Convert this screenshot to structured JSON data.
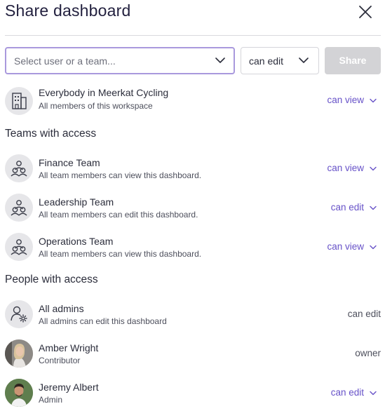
{
  "dialog": {
    "title": "Share dashboard"
  },
  "share_bar": {
    "select_placeholder": "Select user or a team...",
    "permission_value": "can edit",
    "share_label": "Share"
  },
  "everyone": {
    "name": "Everybody in Meerkat Cycling",
    "sub": "All members of this workspace",
    "permission": "can view"
  },
  "teams_section": {
    "heading": "Teams with access",
    "items": [
      {
        "name": "Finance Team",
        "sub": "All team members can view this dashboard.",
        "permission": "can view"
      },
      {
        "name": "Leadership Team",
        "sub": "All team members can edit this dashboard.",
        "permission": "can edit"
      },
      {
        "name": "Operations Team",
        "sub": "All team members can view this dashboard.",
        "permission": "can view"
      }
    ]
  },
  "people_section": {
    "heading": "People with access",
    "items": [
      {
        "name": "All admins",
        "sub": "All admins can edit this dashboard",
        "permission": "can edit"
      },
      {
        "name": "Amber Wright",
        "sub": "Contributor",
        "permission": "owner"
      },
      {
        "name": "Jeremy Albert",
        "sub": "Admin",
        "permission": "can edit"
      }
    ]
  },
  "colors": {
    "accent": "#6752c8",
    "focus_border": "#a999dd",
    "disabled_button": "#d3d3d6",
    "title": "#23213f"
  }
}
